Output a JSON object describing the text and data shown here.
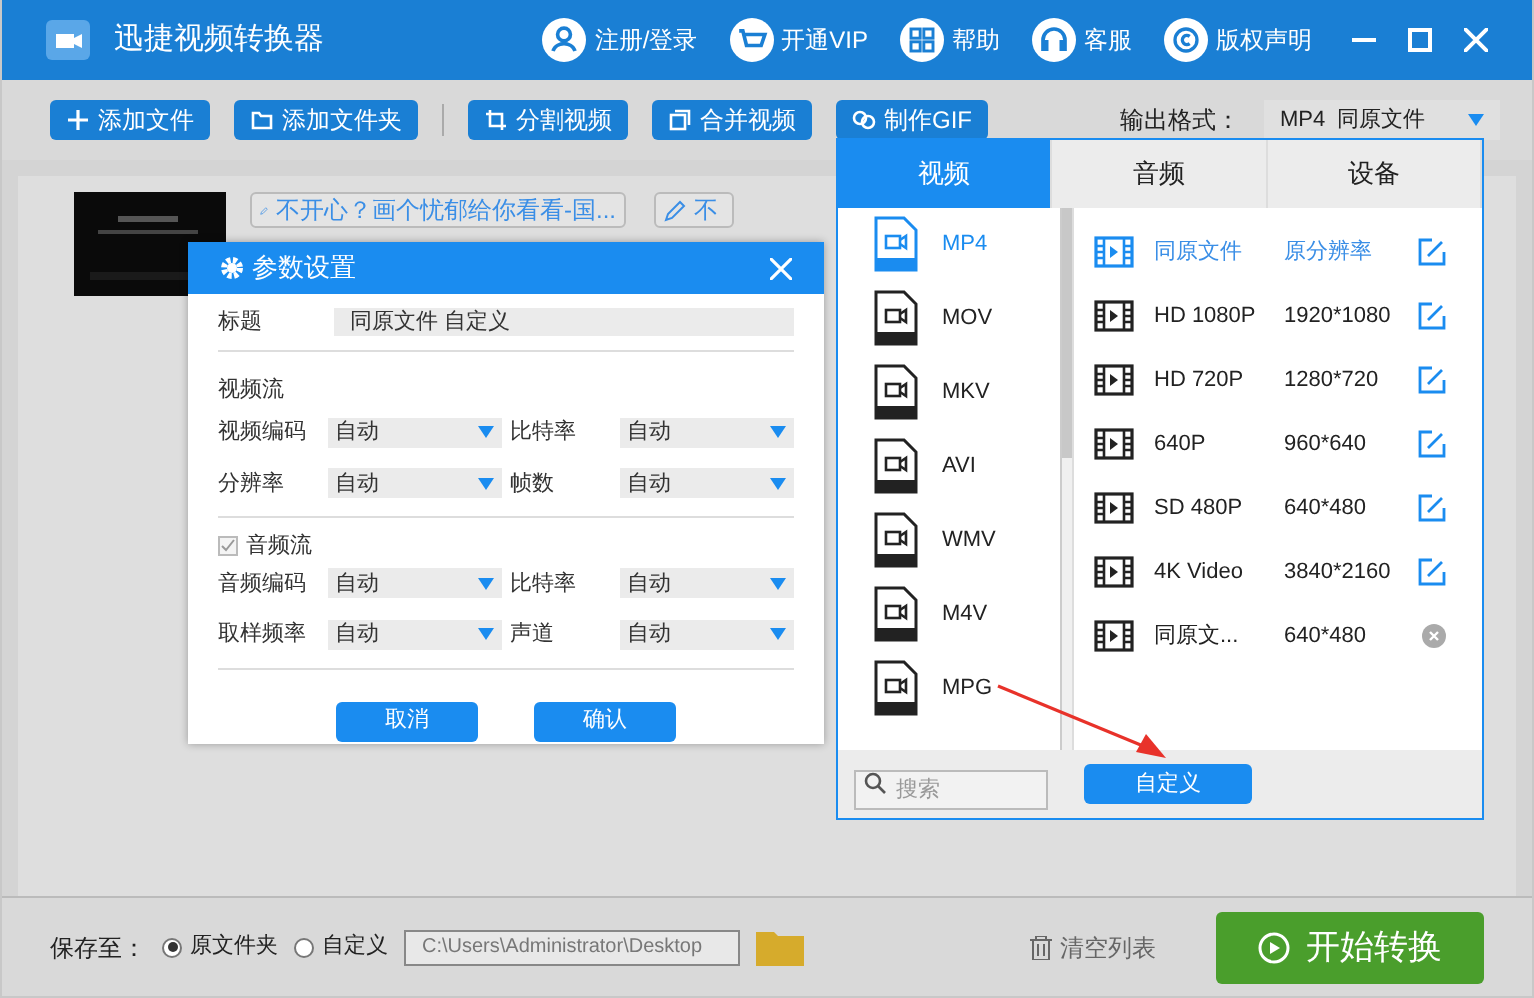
{
  "app": {
    "title": "迅捷视频转换器"
  },
  "header_links": [
    {
      "label": "注册/登录",
      "kind": "user"
    },
    {
      "label": "开通VIP",
      "kind": "cart"
    },
    {
      "label": "帮助",
      "kind": "grid"
    },
    {
      "label": "客服",
      "kind": "headset"
    },
    {
      "label": "版权声明",
      "kind": "copyright"
    }
  ],
  "toolbar": [
    {
      "label": "添加文件",
      "kind": "plus"
    },
    {
      "label": "添加文件夹",
      "kind": "folder"
    },
    {
      "label": "分割视频",
      "kind": "crop"
    },
    {
      "label": "合并视频",
      "kind": "merge"
    },
    {
      "label": "制作GIF",
      "kind": "link"
    }
  ],
  "output_format": {
    "label": "输出格式：",
    "value": "MP4  同原文件"
  },
  "files": [
    {
      "name": "不开心？画个忧郁给你看看-国..."
    },
    {
      "name": "不"
    }
  ],
  "dialog": {
    "title": "参数设置",
    "title_label": "标题",
    "title_value": "同原文件 自定义",
    "video_section": "视频流",
    "video_fields": [
      {
        "label": "视频编码",
        "value": "自动"
      },
      {
        "label": "比特率",
        "value": "自动"
      },
      {
        "label": "分辨率",
        "value": "自动"
      },
      {
        "label": "帧数",
        "value": "自动"
      }
    ],
    "audio_section": {
      "label": "音频流",
      "checked": true
    },
    "audio_fields": [
      {
        "label": "音频编码",
        "value": "自动"
      },
      {
        "label": "比特率",
        "value": "自动"
      },
      {
        "label": "取样频率",
        "value": "自动"
      },
      {
        "label": "声道",
        "value": "自动"
      }
    ],
    "buttons": [
      "取消",
      "确认"
    ]
  },
  "format_panel": {
    "tabs": [
      {
        "label": "视频",
        "selected": true
      },
      {
        "label": "音频",
        "selected": false
      },
      {
        "label": "设备",
        "selected": false
      }
    ],
    "formats": [
      {
        "label": "MP4",
        "selected": true
      },
      {
        "label": "MOV",
        "selected": false
      },
      {
        "label": "MKV",
        "selected": false
      },
      {
        "label": "AVI",
        "selected": false
      },
      {
        "label": "WMV",
        "selected": false
      },
      {
        "label": "M4V",
        "selected": false
      },
      {
        "label": "MPG",
        "selected": false
      }
    ],
    "presets": [
      {
        "name": "同原文件",
        "resolution": "原分辨率",
        "selected": true,
        "kind": "edit"
      },
      {
        "name": "HD 1080P",
        "resolution": "1920*1080",
        "selected": false,
        "kind": "edit"
      },
      {
        "name": "HD 720P",
        "resolution": "1280*720",
        "selected": false,
        "kind": "edit"
      },
      {
        "name": "640P",
        "resolution": "960*640",
        "selected": false,
        "kind": "edit"
      },
      {
        "name": "SD 480P",
        "resolution": "640*480",
        "selected": false,
        "kind": "edit"
      },
      {
        "name": "4K Video",
        "resolution": "3840*2160",
        "selected": false,
        "kind": "edit"
      },
      {
        "name": "同原文...",
        "resolution": "640*480",
        "selected": false,
        "kind": "delete"
      }
    ],
    "search_placeholder": "搜索",
    "custom_button": "自定义"
  },
  "bottom": {
    "save_label": "保存至：",
    "options": [
      {
        "label": "原文件夹",
        "selected": true
      },
      {
        "label": "自定义",
        "selected": false
      }
    ],
    "path": "C:\\Users\\Administrator\\Desktop",
    "clear_label": "清空列表",
    "start_label": "开始转换"
  }
}
